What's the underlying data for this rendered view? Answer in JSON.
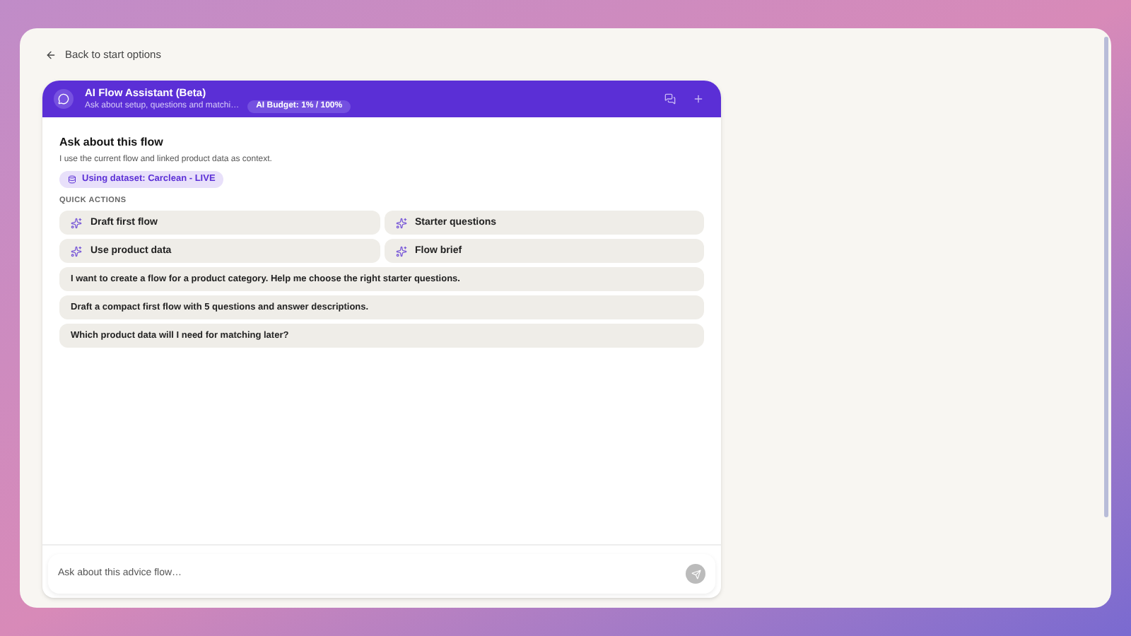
{
  "back_link": {
    "label": "Back to start options"
  },
  "assistant": {
    "title": "AI Flow Assistant (Beta)",
    "subtitle": "Ask about setup, questions and matchi…",
    "budget": "AI Budget: 1% / 100%"
  },
  "intro": {
    "heading": "Ask about this flow",
    "description": "I use the current flow and linked product data as context.",
    "dataset": "Using dataset: Carclean - LIVE"
  },
  "quick_actions": {
    "heading": "QUICK ACTIONS",
    "items": [
      {
        "kind": "action",
        "label": "Draft first flow"
      },
      {
        "kind": "action",
        "label": "Starter questions"
      },
      {
        "kind": "action",
        "label": "Use product data"
      },
      {
        "kind": "action",
        "label": "Flow brief"
      },
      {
        "kind": "prompt",
        "label": "I want to create a flow for a product category. Help me choose the right starter questions."
      },
      {
        "kind": "prompt",
        "label": "Draft a compact first flow with 5 questions and answer descriptions."
      },
      {
        "kind": "prompt",
        "label": "Which product data will I need for matching later?"
      }
    ]
  },
  "composer": {
    "placeholder": "Ask about this advice flow…"
  }
}
